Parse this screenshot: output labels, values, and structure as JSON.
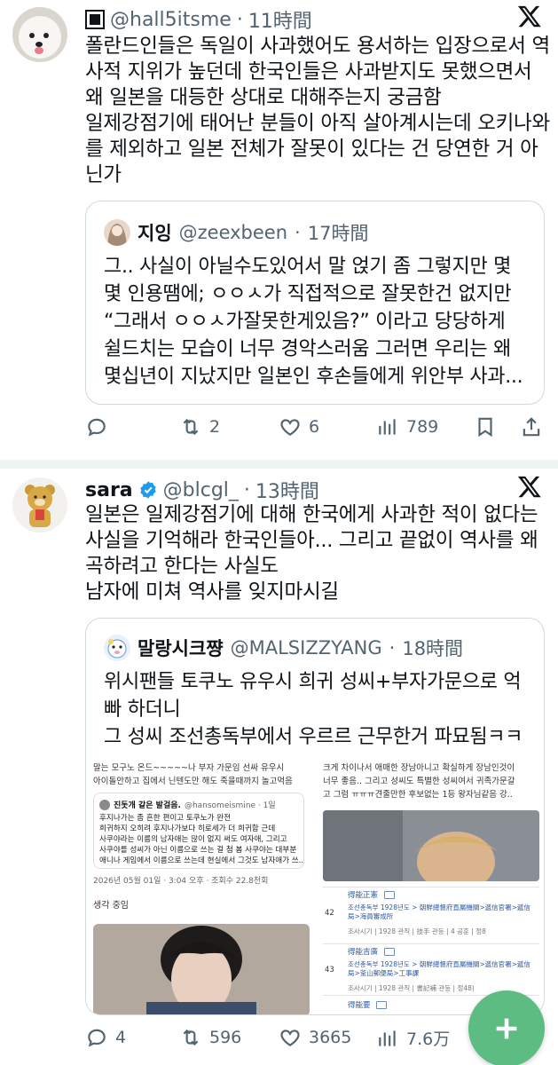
{
  "colors": {
    "accent": "#1d9bf0",
    "muted": "#536471",
    "fab": "#5dbc82"
  },
  "tweet1": {
    "name_icon": "black-square-name-icon",
    "handle": "@hall5itsme",
    "time": "11時間",
    "lines": [
      "폴란드인들은 독일이 사과했어도 용서하는 입장으로서 역",
      "사적 지위가 높던데 한국인들은 사과받지도 못했으면서",
      "왜 일본을 대등한 상대로 대해주는지 궁금함",
      "일제강점기에 태어난 분들이 아직 살아계시는데 오키나와",
      "를 제외하고 일본 전체가  잘못이 있다는 건 당연한 거 아",
      "닌가"
    ],
    "quote": {
      "name": "지잉",
      "handle": "@zeexbeen",
      "time": "17時間",
      "lines": [
        "그.. 사실이 아닐수도있어서 말 얹기 좀 그렇지만 몇",
        "몇 인용땜에; ㅇㅇㅅ가 직접적으로 잘못한건 없지만",
        "“그래서 ㅇㅇㅅ가잘못한게있음?” 이라고 당당하게",
        "쉴드치는 모습이 너무 경악스러움 그러면 우리는 왜",
        "몇십년이 지났지만 일본인 후손들에게 위안부 사과..."
      ]
    },
    "stats": {
      "replies": "",
      "retweets": "2",
      "likes": "6",
      "views": "789"
    }
  },
  "tweet2": {
    "name": "sara",
    "handle": "@blcgl_",
    "time": "13時間",
    "lines": [
      "일본은 일제강점기에 대해 한국에게 사과한 적이 없다는",
      "사실을 기억해라 한국인들아... 그리고 끝없이 역사를 왜",
      "곡하려고 한다는 사실도",
      "남자에 미쳐 역사를 잊지마시길"
    ],
    "quote": {
      "name": "말랑시크쨩",
      "handle": "@MALSIZZYANG",
      "time": "18時間",
      "lines": [
        "위시팬들 토쿠노 유우시 희귀 성씨+부자가문으로 억",
        "빠 하더니",
        "그 성씨 조선총독부에서 우르르 근무한거 파묘됨ㅋㅋ"
      ],
      "media_left": {
        "top_lines": [
          "말는 모구노 온드~~~~~나 부자 가문임 선싸 유우시",
          "아이돌안하고 집에서 닌텐도만 해도 죽을때까지 놀고먹음"
        ],
        "inner_name": "진돗개 같은 발걸음.",
        "inner_handle": "@hansomeismine · 1일",
        "inner_lines": [
          "후지나가는 좀 흔한 편이고 토쿠노가 완전",
          "희귀하지 오히려 후지나가보다 히로세가 더 희귀함 근데",
          "사쿠야라는 이름의 남자애는 많이 없지 써도 여자애, 그리고",
          "사쿠야를 성씨가 아닌 이름으로 쓰는 걸 첨 봄 사쿠야는 대부분",
          "애니나 게임에서 이름으로 쓰는데 현실에서 그것도 남자애가 쓰..."
        ],
        "meta": "2026년 05월 01일 · 3:04 오후 · 조회수 22.8천회",
        "caption": "생각 중임"
      },
      "media_right": {
        "top_lines": [
          "크게 차이나서 애매한 장남아니고 확실하게 장남인것이",
          "너무 좋음.. 그리고 성씨도 특별한 성씨여서 귀족가문갈",
          "고 그럼 ㅠㅠㅠ견줄만한 후보없는 1등 왕자님같음 강.."
        ],
        "rows": [
          {
            "label": "得能正憲",
            "num": "42",
            "text": "조선총독부 1928년도 > 朝鮮總督府直屬機關>遞信官署>遞信局>海員審成所",
            "sub": "조사시기 | 1928 관직 | 技手 관등 | 4 공훈 | 정8"
          },
          {
            "label": "得能吉廣",
            "num": "43",
            "text": "조선총독부 1928년도 > 朝鮮總督府直屬機關>遞信官署>遞信局>釜山郵便局>工事課",
            "sub": "조사시기 | 1928 관직 | 書記補 관등 | 정48)"
          },
          {
            "label": "得能要",
            "num": "",
            "text": "",
            "sub": ""
          }
        ]
      }
    },
    "stats": {
      "replies": "4",
      "retweets": "596",
      "likes": "3665",
      "views": "7.6万"
    }
  }
}
